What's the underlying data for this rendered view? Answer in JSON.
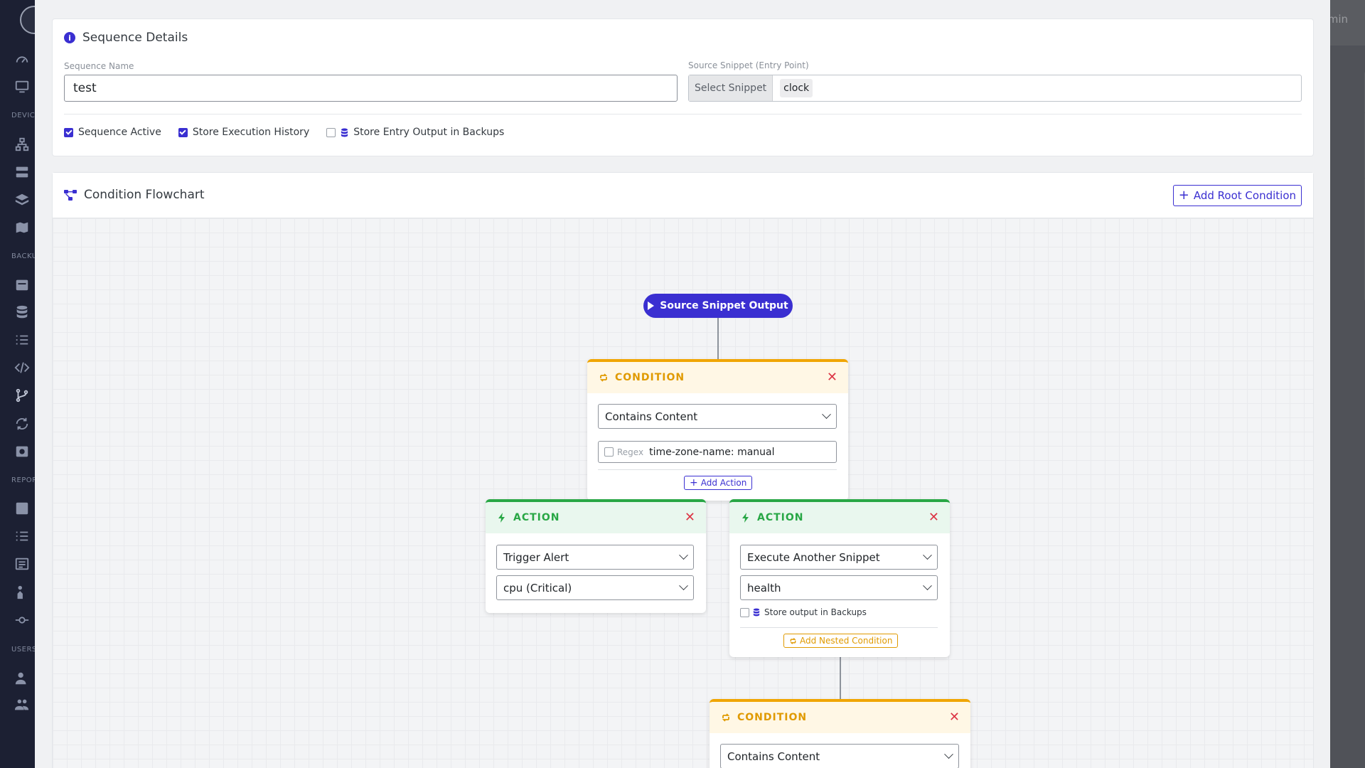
{
  "background": {
    "user_label": "min",
    "sidebar_sections": [
      "DEVIC",
      "BACKU",
      "REPOR",
      "USERS"
    ]
  },
  "details": {
    "title": "Sequence Details",
    "name_label": "Sequence Name",
    "name_value": "test",
    "source_label": "Source Snippet (Entry Point)",
    "select_snippet_label": "Select Snippet",
    "selected_snippet": "clock",
    "checkboxes": [
      {
        "label": "Sequence Active",
        "checked": true
      },
      {
        "label": "Store Execution History",
        "checked": true
      },
      {
        "label": "Store Entry Output in Backups",
        "checked": false
      }
    ]
  },
  "flowchart": {
    "title": "Condition Flowchart",
    "add_root_label": "Add Root Condition",
    "source_node_label": "Source Snippet Output",
    "condition1": {
      "header": "CONDITION",
      "type": "Contains Content",
      "regex_label": "Regex",
      "regex_checked": false,
      "value": "time-zone-name: manual",
      "add_action_label": "Add Action"
    },
    "action1": {
      "header": "ACTION",
      "type": "Trigger Alert",
      "target": "cpu (Critical)"
    },
    "action2": {
      "header": "ACTION",
      "type": "Execute Another Snippet",
      "target": "health",
      "store_label": "Store output in Backups",
      "store_checked": false,
      "add_nested_label": "Add Nested Condition"
    },
    "condition2": {
      "header": "CONDITION",
      "type": "Contains Content"
    }
  },
  "colors": {
    "primary": "#3a2fd1",
    "condition": "#f0a500",
    "action": "#28a745",
    "danger": "#dc3545"
  }
}
